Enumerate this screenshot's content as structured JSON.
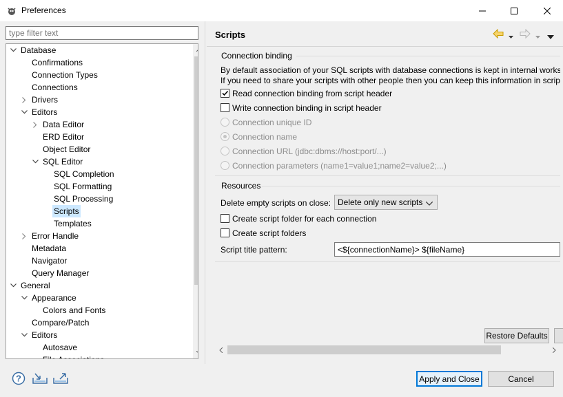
{
  "window": {
    "title": "Preferences"
  },
  "filter": {
    "placeholder": "type filter text"
  },
  "tree": [
    {
      "label": "Database",
      "level": 0,
      "toggle": "expanded"
    },
    {
      "label": "Confirmations",
      "level": 1,
      "toggle": "none"
    },
    {
      "label": "Connection Types",
      "level": 1,
      "toggle": "none"
    },
    {
      "label": "Connections",
      "level": 1,
      "toggle": "none"
    },
    {
      "label": "Drivers",
      "level": 1,
      "toggle": "collapsed"
    },
    {
      "label": "Editors",
      "level": 1,
      "toggle": "expanded"
    },
    {
      "label": "Data Editor",
      "level": 2,
      "toggle": "collapsed"
    },
    {
      "label": "ERD Editor",
      "level": 2,
      "toggle": "none"
    },
    {
      "label": "Object Editor",
      "level": 2,
      "toggle": "none"
    },
    {
      "label": "SQL Editor",
      "level": 2,
      "toggle": "expanded"
    },
    {
      "label": "SQL Completion",
      "level": 3,
      "toggle": "none"
    },
    {
      "label": "SQL Formatting",
      "level": 3,
      "toggle": "none"
    },
    {
      "label": "SQL Processing",
      "level": 3,
      "toggle": "none"
    },
    {
      "label": "Scripts",
      "level": 3,
      "toggle": "none",
      "selected": true
    },
    {
      "label": "Templates",
      "level": 3,
      "toggle": "none"
    },
    {
      "label": "Error Handle",
      "level": 1,
      "toggle": "collapsed"
    },
    {
      "label": "Metadata",
      "level": 1,
      "toggle": "none"
    },
    {
      "label": "Navigator",
      "level": 1,
      "toggle": "none"
    },
    {
      "label": "Query Manager",
      "level": 1,
      "toggle": "none"
    },
    {
      "label": "General",
      "level": 0,
      "toggle": "expanded"
    },
    {
      "label": "Appearance",
      "level": 1,
      "toggle": "expanded"
    },
    {
      "label": "Colors and Fonts",
      "level": 2,
      "toggle": "none"
    },
    {
      "label": "Compare/Patch",
      "level": 1,
      "toggle": "none"
    },
    {
      "label": "Editors",
      "level": 1,
      "toggle": "expanded"
    },
    {
      "label": "Autosave",
      "level": 2,
      "toggle": "none"
    },
    {
      "label": "File Associations",
      "level": 2,
      "toggle": "none"
    }
  ],
  "page": {
    "title": "Scripts",
    "connection_binding": {
      "title": "Connection binding",
      "desc1": "By default association of your SQL scripts with database connections is kept in internal worksp",
      "desc2": "If you need to share your scripts with other people then you can keep this information in scrip",
      "read_header_label": "Read connection binding from script header",
      "read_header_checked": true,
      "write_header_label": "Write connection binding in script header",
      "write_header_checked": false,
      "radio_unique_id": "Connection unique ID",
      "radio_name": "Connection name",
      "radio_url": "Connection URL (jdbc:dbms://host:port/...)",
      "radio_params": "Connection parameters (name1=value1;name2=value2;...)",
      "selected_radio": "name"
    },
    "resources": {
      "title": "Resources",
      "delete_label": "Delete empty scripts on close:",
      "delete_value": "Delete only new scripts",
      "folder_per_connection_label": "Create script folder for each connection",
      "create_folders_label": "Create script folders",
      "title_pattern_label": "Script title pattern:",
      "title_pattern_value": "<${connectionName}> ${fileName}"
    },
    "restore_defaults": "Restore Defaults"
  },
  "footer": {
    "apply_close": "Apply and Close",
    "cancel": "Cancel"
  },
  "colors": {
    "selection": "#cce8ff",
    "button_focus_border": "#0078d7",
    "nav_arrow": "#e6b800"
  }
}
